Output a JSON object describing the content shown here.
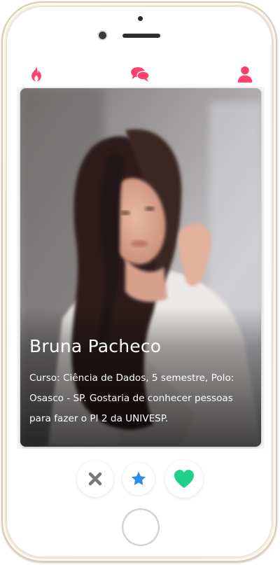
{
  "colors": {
    "accent": "#ff3f6c",
    "star": "#2b8fe8",
    "heart": "#21d18a",
    "close": "#777777"
  },
  "topbar": {
    "left_icon": "flame-icon",
    "center_icon": "chat-bubbles-icon",
    "right_icon": "user-icon"
  },
  "profile": {
    "name": "Bruna Pacheco",
    "bio": "Curso: Ciência de Dados, 5 semestre, Polo: Osasco - SP. Gostaria de conhecer pessoas para fazer o PI 2 da UNIVESP."
  },
  "actions": {
    "dislike_icon": "close-icon",
    "superlike_icon": "star-icon",
    "like_icon": "heart-icon"
  }
}
